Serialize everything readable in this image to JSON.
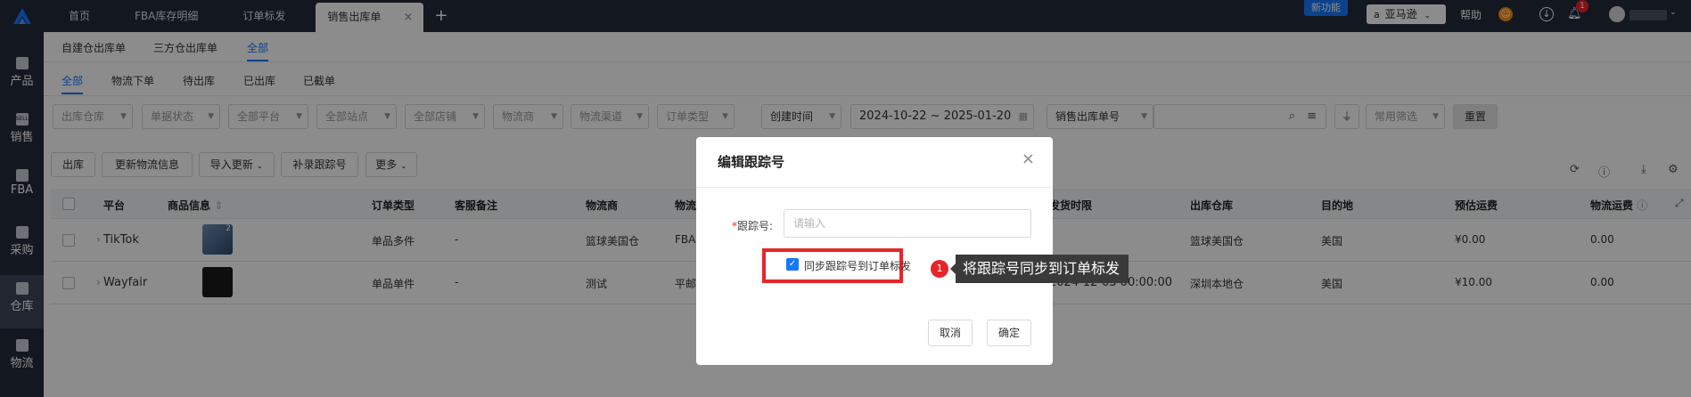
{
  "topbar": {
    "tabs": [
      {
        "label": "首页"
      },
      {
        "label": "FBA库存明细"
      },
      {
        "label": "订单标发"
      },
      {
        "label": "销售出库单",
        "close": "×"
      }
    ],
    "add_tab": "+",
    "new_feature": "新功能",
    "marketplace": "亚马逊",
    "help": "帮助",
    "notification_count": "1"
  },
  "sidebar": {
    "items": [
      {
        "label": "产品",
        "icon": "product-icon"
      },
      {
        "label": "销售",
        "icon": "sell-icon",
        "icon_text": "SELL"
      },
      {
        "label": "FBA",
        "icon": "fba-icon"
      },
      {
        "label": "采购",
        "icon": "cart-icon"
      },
      {
        "label": "仓库",
        "icon": "warehouse-icon"
      },
      {
        "label": "物流",
        "icon": "truck-icon"
      }
    ]
  },
  "subtabs": [
    "自建仓出库单",
    "三方仓出库单",
    "全部"
  ],
  "status_tabs": [
    "全部",
    "物流下单",
    "待出库",
    "已出库",
    "已截单"
  ],
  "filters": {
    "outbound_warehouse": "出库仓库",
    "doc_status": "单据状态",
    "all_platforms": "全部平台",
    "all_sites": "全部站点",
    "all_stores": "全部店铺",
    "logistics_provider": "物流商",
    "logistics_channel": "物流渠道",
    "order_type": "订单类型",
    "created_time": "创建时间",
    "date_range": "2024-10-22 ~ 2025-01-20",
    "search_field": "销售出库单号",
    "common_filter": "常用筛选",
    "reset": "重置"
  },
  "actions": {
    "outbound": "出库",
    "update_logistics": "更新物流信息",
    "import_update": "导入更新",
    "add_tracking": "补录跟踪号",
    "more": "更多"
  },
  "table": {
    "headers": {
      "platform": "平台",
      "product_info": "商品信息",
      "order_type": "订单类型",
      "customer_note": "客服备注",
      "logistics_provider": "物流商",
      "logistics_partial": "物流",
      "ship_deadline": "发货时限",
      "outbound_warehouse": "出库仓库",
      "destination": "目的地",
      "estimated_freight": "预估运费",
      "logistics_freight": "物流运费"
    },
    "rows": [
      {
        "platform": "TikTok",
        "thumb_badge": "2",
        "order_type": "单品多件",
        "note": "-",
        "provider": "篮球美国仓",
        "channel": "FBA",
        "deadline": "",
        "warehouse": "篮球美国仓",
        "destination": "美国",
        "est_freight": "¥0.00",
        "freight": "0.00"
      },
      {
        "platform": "Wayfair",
        "thumb_badge": "",
        "order_type": "单品单件",
        "note": "-",
        "provider": "测试",
        "channel": "平邮",
        "deadline": "2024-12-03 00:00:00",
        "warehouse": "深圳本地仓",
        "destination": "美国",
        "est_freight": "¥10.00",
        "freight": "0.00"
      }
    ]
  },
  "modal": {
    "title": "编辑跟踪号",
    "close": "×",
    "field_label": "跟踪号:",
    "required_mark": "*",
    "placeholder": "请输入",
    "sync_label": "同步跟踪号到订单标发",
    "sync_checked": true,
    "cancel": "取消",
    "confirm": "确定"
  },
  "annotation": {
    "step": "1",
    "text": "将跟踪号同步到订单标发",
    "color": "#e5252a"
  },
  "colors": {
    "accent": "#1677ff",
    "sidebar": "#232b3b"
  }
}
